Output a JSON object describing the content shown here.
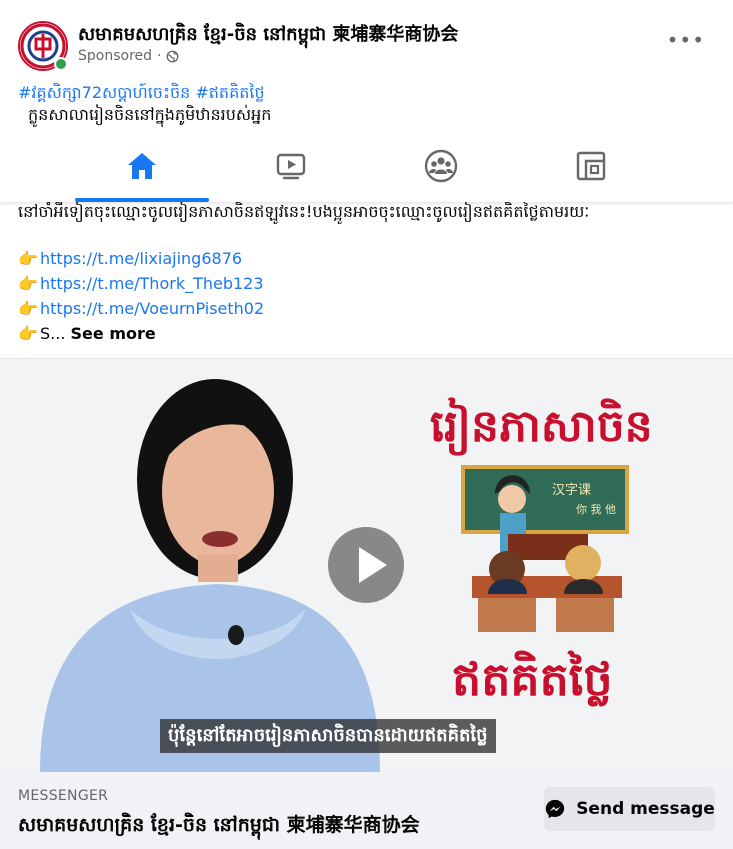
{
  "post": {
    "page_name": "សមាគមសហគ្រិន ខ្មែរ-ចិន នៅកម្ពុជា 柬埔寨华商协会",
    "sponsored": "Sponsored",
    "more": "•••",
    "hashtags": "#វគ្គសិក្សា72សប្តាហ៍ចេះចិន #ឥតគិតថ្លៃ",
    "line1": "ក្លូនសាលារៀនចិននៅក្នុងភូមិឋានរបស់អ្នក",
    "body_cont": "នៅចាំអីទៀតចុះឈ្មោះចូលរៀនភាសាចិនឥឡូវនេះ!បងប្អូនអាចចុះឈ្មោះចូលរៀនឥតគិតថ្លៃតាមរយៈ",
    "finger": "👉",
    "links": [
      "https://t.me/lixiajing6876",
      "https://t.me/Thork_Theb123",
      "https://t.me/VoeurnPiseth02"
    ],
    "truncated_prefix": "S...",
    "see_more": "See more"
  },
  "nav": {
    "tabs": [
      {
        "icon": "home-icon",
        "active": true
      },
      {
        "icon": "video-icon",
        "active": false
      },
      {
        "icon": "groups-icon",
        "active": false
      },
      {
        "icon": "gaming-icon",
        "active": false
      }
    ],
    "accent": "#1877f2"
  },
  "media": {
    "title": "រៀនភាសាចិន",
    "board_text": "汉字课",
    "board_small": "你 我 他",
    "free": "ឥតគិតថ្លៃ",
    "caption": "ប៉ុន្តែនៅតែអាចរៀនភាសាចិនបានដោយឥតគិតថ្លៃ"
  },
  "footer": {
    "label": "MESSENGER",
    "name": "សមាគមសហគ្រិន ខ្មែរ-ចិន នៅកម្ពុជា 柬埔寨华商协会",
    "button": "Send message"
  }
}
